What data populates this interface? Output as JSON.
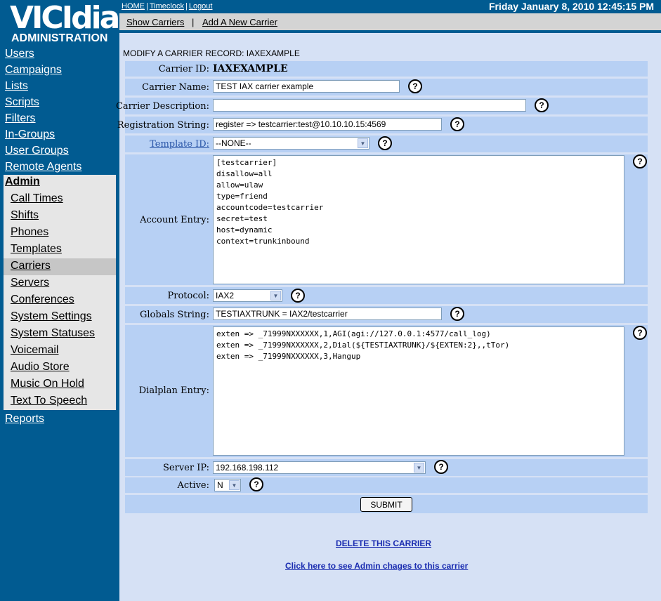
{
  "logo": {
    "brand": "VICIdial",
    "subtitle": "ADMINISTRATION"
  },
  "nav": {
    "top_items": [
      "Users",
      "Campaigns",
      "Lists",
      "Scripts",
      "Filters",
      "In-Groups",
      "User Groups",
      "Remote Agents"
    ],
    "admin_label": "Admin",
    "admin_items": [
      "Call Times",
      "Shifts",
      "Phones",
      "Templates",
      "Carriers",
      "Servers",
      "Conferences",
      "System Settings",
      "System Statuses",
      "Voicemail",
      "Audio Store",
      "Music On Hold",
      "Text To Speech"
    ],
    "active_item": "Carriers",
    "reports_label": "Reports"
  },
  "topbar": {
    "home": "HOME",
    "timeclock": "Timeclock",
    "logout": "Logout",
    "datetime": "Friday January 8, 2010 12:45:15 PM"
  },
  "subbar": {
    "show_carriers": "Show Carriers",
    "add_carrier": "Add A New Carrier"
  },
  "heading": "MODIFY A CARRIER RECORD: IAXEXAMPLE",
  "form": {
    "carrier_id_label": "Carrier ID:",
    "carrier_id_value": "IAXEXAMPLE",
    "carrier_name_label": "Carrier Name:",
    "carrier_name_value": "TEST IAX carrier example",
    "carrier_desc_label": "Carrier Description:",
    "carrier_desc_value": "",
    "registration_label": "Registration String:",
    "registration_value": "register => testcarrier:test@10.10.10.15:4569",
    "template_label": "Template ID:",
    "template_value": "--NONE--",
    "account_label": "Account Entry:",
    "account_value": "[testcarrier]\ndisallow=all\nallow=ulaw\ntype=friend\naccountcode=testcarrier\nsecret=test\nhost=dynamic\ncontext=trunkinbound",
    "protocol_label": "Protocol:",
    "protocol_value": "IAX2",
    "globals_label": "Globals String:",
    "globals_value": "TESTIAXTRUNK = IAX2/testcarrier",
    "dialplan_label": "Dialplan Entry:",
    "dialplan_value": "exten => _71999NXXXXXX,1,AGI(agi://127.0.0.1:4577/call_log)\nexten => _71999NXXXXXX,2,Dial(${TESTIAXTRUNK}/${EXTEN:2},,tTor)\nexten => _71999NXXXXXX,3,Hangup",
    "server_ip_label": "Server IP:",
    "server_ip_value": "192.168.198.112",
    "active_label": "Active:",
    "active_value": "N",
    "submit_label": "SUBMIT",
    "help_glyph": "?"
  },
  "links": {
    "delete": "DELETE THIS CARRIER",
    "changes": "Click here to see Admin chages to this carrier"
  }
}
